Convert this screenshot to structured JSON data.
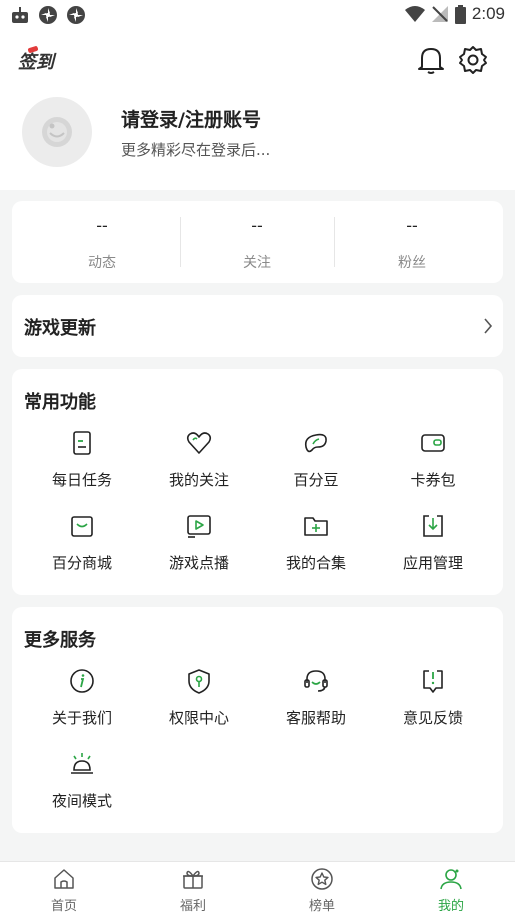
{
  "status_bar": {
    "time": "2:09"
  },
  "header": {
    "sign_label": "签到",
    "login_title": "请登录/注册账号",
    "login_subtitle": "更多精彩尽在登录后..."
  },
  "stats": [
    {
      "value": "--",
      "label": "动态"
    },
    {
      "value": "--",
      "label": "关注"
    },
    {
      "value": "--",
      "label": "粉丝"
    }
  ],
  "game_update": {
    "label": "游戏更新"
  },
  "common_functions": {
    "title": "常用功能",
    "items": [
      {
        "label": "每日任务",
        "icon": "task-icon"
      },
      {
        "label": "我的关注",
        "icon": "heart-icon"
      },
      {
        "label": "百分豆",
        "icon": "bean-icon"
      },
      {
        "label": "卡券包",
        "icon": "wallet-icon"
      },
      {
        "label": "百分商城",
        "icon": "bag-icon"
      },
      {
        "label": "游戏点播",
        "icon": "play-icon"
      },
      {
        "label": "我的合集",
        "icon": "folder-add-icon"
      },
      {
        "label": "应用管理",
        "icon": "download-box-icon"
      }
    ]
  },
  "more_services": {
    "title": "更多服务",
    "items": [
      {
        "label": "关于我们",
        "icon": "info-icon"
      },
      {
        "label": "权限中心",
        "icon": "shield-key-icon"
      },
      {
        "label": "客服帮助",
        "icon": "headset-icon"
      },
      {
        "label": "意见反馈",
        "icon": "feedback-icon"
      },
      {
        "label": "夜间模式",
        "icon": "night-lamp-icon"
      }
    ]
  },
  "bottom_nav": [
    {
      "label": "首页",
      "icon": "home-icon"
    },
    {
      "label": "福利",
      "icon": "gift-icon"
    },
    {
      "label": "榜单",
      "icon": "star-badge-icon"
    },
    {
      "label": "我的",
      "icon": "profile-icon",
      "active": true
    }
  ],
  "colors": {
    "accent": "#2ba545",
    "background": "#f4f5f5",
    "card": "#ffffff"
  }
}
